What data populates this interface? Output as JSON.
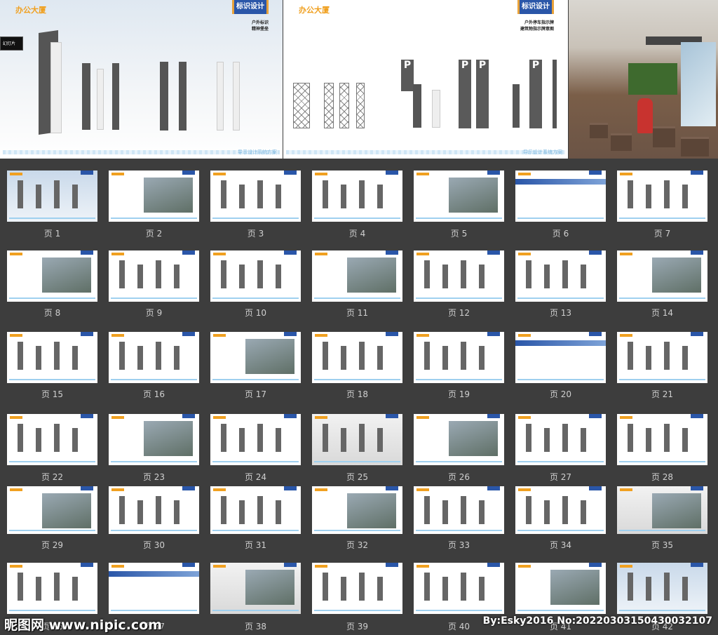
{
  "preview": {
    "slide_a": {
      "logo": "办公大厦",
      "tag": "标识设计",
      "subtitle": [
        "户外标识",
        "精神堡垒"
      ],
      "footer": "导示设计系统方案",
      "tooltip": "幻灯片"
    },
    "slide_b": {
      "logo": "办公大厦",
      "tag": "标识设计",
      "subtitle": [
        "户外停车指示牌",
        "建筑物指示牌意图"
      ],
      "footer": "导示设计系统方案",
      "parking": "P"
    }
  },
  "thumbnails": [
    "页 1",
    "页 2",
    "页 3",
    "页 4",
    "页 5",
    "页 6",
    "页 7",
    "页 8",
    "页 9",
    "页 10",
    "页 11",
    "页 12",
    "页 13",
    "页 14",
    "页 15",
    "页 16",
    "页 17",
    "页 18",
    "页 19",
    "页 20",
    "页 21",
    "页 22",
    "页 23",
    "页 24",
    "页 25",
    "页 26",
    "页 27",
    "页 28",
    "页 29",
    "页 30",
    "页 31",
    "页 32",
    "页 33",
    "页 34",
    "页 35",
    "页 36",
    "页 37",
    "页 38",
    "页 39",
    "页 40",
    "页 41",
    "页 42"
  ],
  "watermark": {
    "site": "昵图网 www.nipic.com",
    "id": "By:Esky2016 No:20220303150430032107"
  }
}
